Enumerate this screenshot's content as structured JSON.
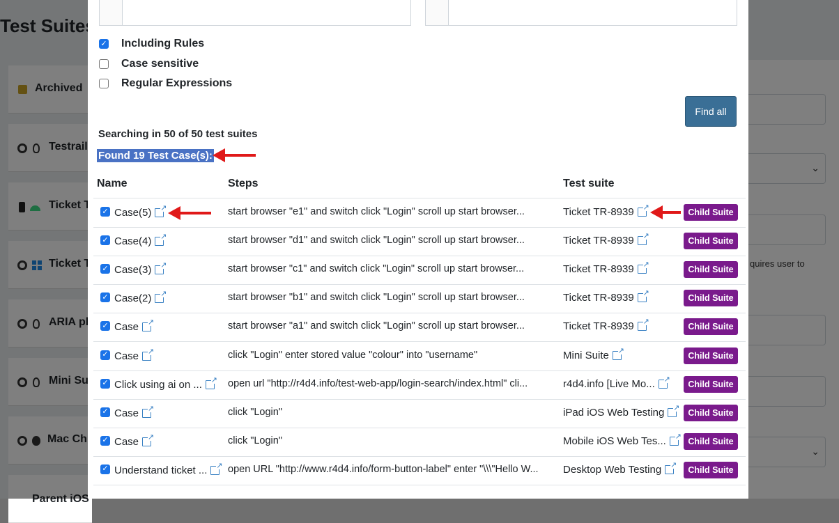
{
  "background": {
    "page_title": "Test Suites",
    "items": [
      {
        "label": "Archived"
      },
      {
        "label": "Testrail"
      },
      {
        "label": "Ticket T"
      },
      {
        "label": "Ticket T"
      },
      {
        "label": "ARIA pla"
      },
      {
        "label": "Mini Sui"
      },
      {
        "label": "Mac Chr"
      },
      {
        "label": "Parent iOS"
      }
    ],
    "note": "quires user to"
  },
  "modal": {
    "options": [
      {
        "label": "Including Rules",
        "checked": true
      },
      {
        "label": "Case sensitive",
        "checked": false
      },
      {
        "label": "Regular Expressions",
        "checked": false
      }
    ],
    "find_all_label": "Find all",
    "searching_text": "Searching in 50 of 50 test suites",
    "found_text": "Found 19 Test Case(s):",
    "columns": {
      "name": "Name",
      "steps": "Steps",
      "suite": "Test suite"
    },
    "child_suite_label": "Child Suite",
    "rows": [
      {
        "name": "Case(5)",
        "steps": "start browser \"e1\" and switch click \"Login\" scroll up start browser...",
        "suite": "Ticket TR-8939"
      },
      {
        "name": "Case(4)",
        "steps": "start browser \"d1\" and switch click \"Login\" scroll up start browser...",
        "suite": "Ticket TR-8939"
      },
      {
        "name": "Case(3)",
        "steps": "start browser \"c1\" and switch click \"Login\" scroll up start browser...",
        "suite": "Ticket TR-8939"
      },
      {
        "name": "Case(2)",
        "steps": "start browser \"b1\" and switch click \"Login\" scroll up start browser...",
        "suite": "Ticket TR-8939"
      },
      {
        "name": "Case",
        "steps": "start browser \"a1\" and switch click \"Login\" scroll up start browser...",
        "suite": "Ticket TR-8939"
      },
      {
        "name": "Case",
        "steps": "click \"Login\" enter stored value \"colour\" into \"username\"",
        "suite": "Mini Suite"
      },
      {
        "name": "Click using ai on ...",
        "steps": "open url \"http://r4d4.info/test-web-app/login-search/index.html\" cli...",
        "suite": "r4d4.info [Live Mo..."
      },
      {
        "name": "Case",
        "steps": "click \"Login\"",
        "suite": "iPad iOS Web Testing"
      },
      {
        "name": "Case",
        "steps": "click \"Login\"",
        "suite": "Mobile iOS Web Tes..."
      },
      {
        "name": "Understand ticket ...",
        "steps": "open URL \"http://www.r4d4.info/form-button-label\" enter \"\\\\\\\"Hello W...",
        "suite": "Desktop Web Testing"
      }
    ]
  },
  "colors": {
    "accent": "#1a73e8",
    "find_button": "#3a6f96",
    "child_button": "#7a1a8c",
    "highlight": "#4a72c4",
    "arrow": "#e01919"
  }
}
